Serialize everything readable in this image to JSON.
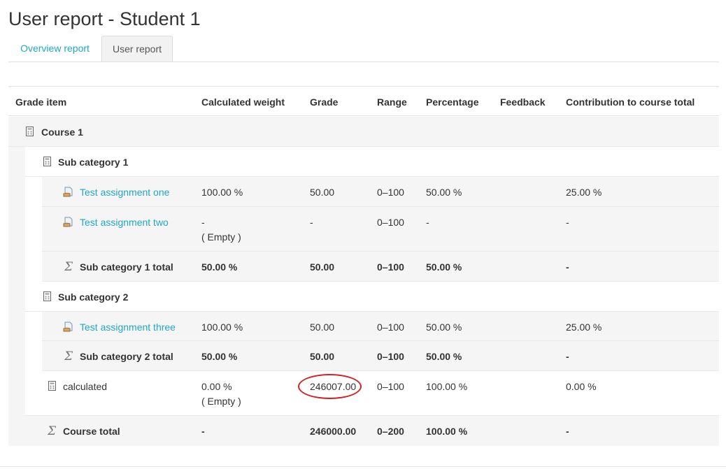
{
  "page": {
    "title": "User report - Student 1"
  },
  "tabs": [
    {
      "label": "Overview report",
      "active": false
    },
    {
      "label": "User report",
      "active": true
    }
  ],
  "table": {
    "headers": [
      "Grade item",
      "Calculated weight",
      "Grade",
      "Range",
      "Percentage",
      "Feedback",
      "Contribution to course total"
    ],
    "course": {
      "name": "Course 1",
      "icon": "category-icon"
    },
    "subcat1": {
      "name": "Sub category 1",
      "items": [
        {
          "name": "Test assignment one",
          "icon": "assignment-icon",
          "weight": "100.00 %",
          "grade": "50.00",
          "range": "0–100",
          "percentage": "50.00 %",
          "contribution": "25.00 %"
        },
        {
          "name": "Test assignment two",
          "icon": "assignment-icon",
          "weight": "-",
          "weight_note": "( Empty )",
          "grade": "-",
          "range": "0–100",
          "percentage": "-",
          "contribution": "-"
        }
      ],
      "total": {
        "name": "Sub category 1 total",
        "icon": "sigma-icon",
        "weight": "50.00 %",
        "grade": "50.00",
        "range": "0–100",
        "percentage": "50.00 %",
        "contribution": "-"
      }
    },
    "subcat2": {
      "name": "Sub category 2",
      "items": [
        {
          "name": "Test assignment three",
          "icon": "assignment-icon",
          "weight": "100.00 %",
          "grade": "50.00",
          "range": "0–100",
          "percentage": "50.00 %",
          "contribution": "25.00 %"
        }
      ],
      "total": {
        "name": "Sub category 2 total",
        "icon": "sigma-icon",
        "weight": "50.00 %",
        "grade": "50.00",
        "range": "0–100",
        "percentage": "50.00 %",
        "contribution": "-"
      }
    },
    "calculated": {
      "name": "calculated",
      "icon": "calculator-icon",
      "weight": "0.00 %",
      "weight_note": "( Empty )",
      "grade": "246007.00",
      "range": "0–100",
      "percentage": "100.00 %",
      "contribution": "0.00 %"
    },
    "course_total": {
      "name": "Course total",
      "icon": "sigma-icon",
      "weight": "-",
      "grade": "246000.00",
      "range": "0–200",
      "percentage": "100.00 %",
      "contribution": "-"
    }
  },
  "colors": {
    "link": "#1fa7c7",
    "highlight_circle": "#d42020",
    "row_shade": "#f5f5f5"
  }
}
